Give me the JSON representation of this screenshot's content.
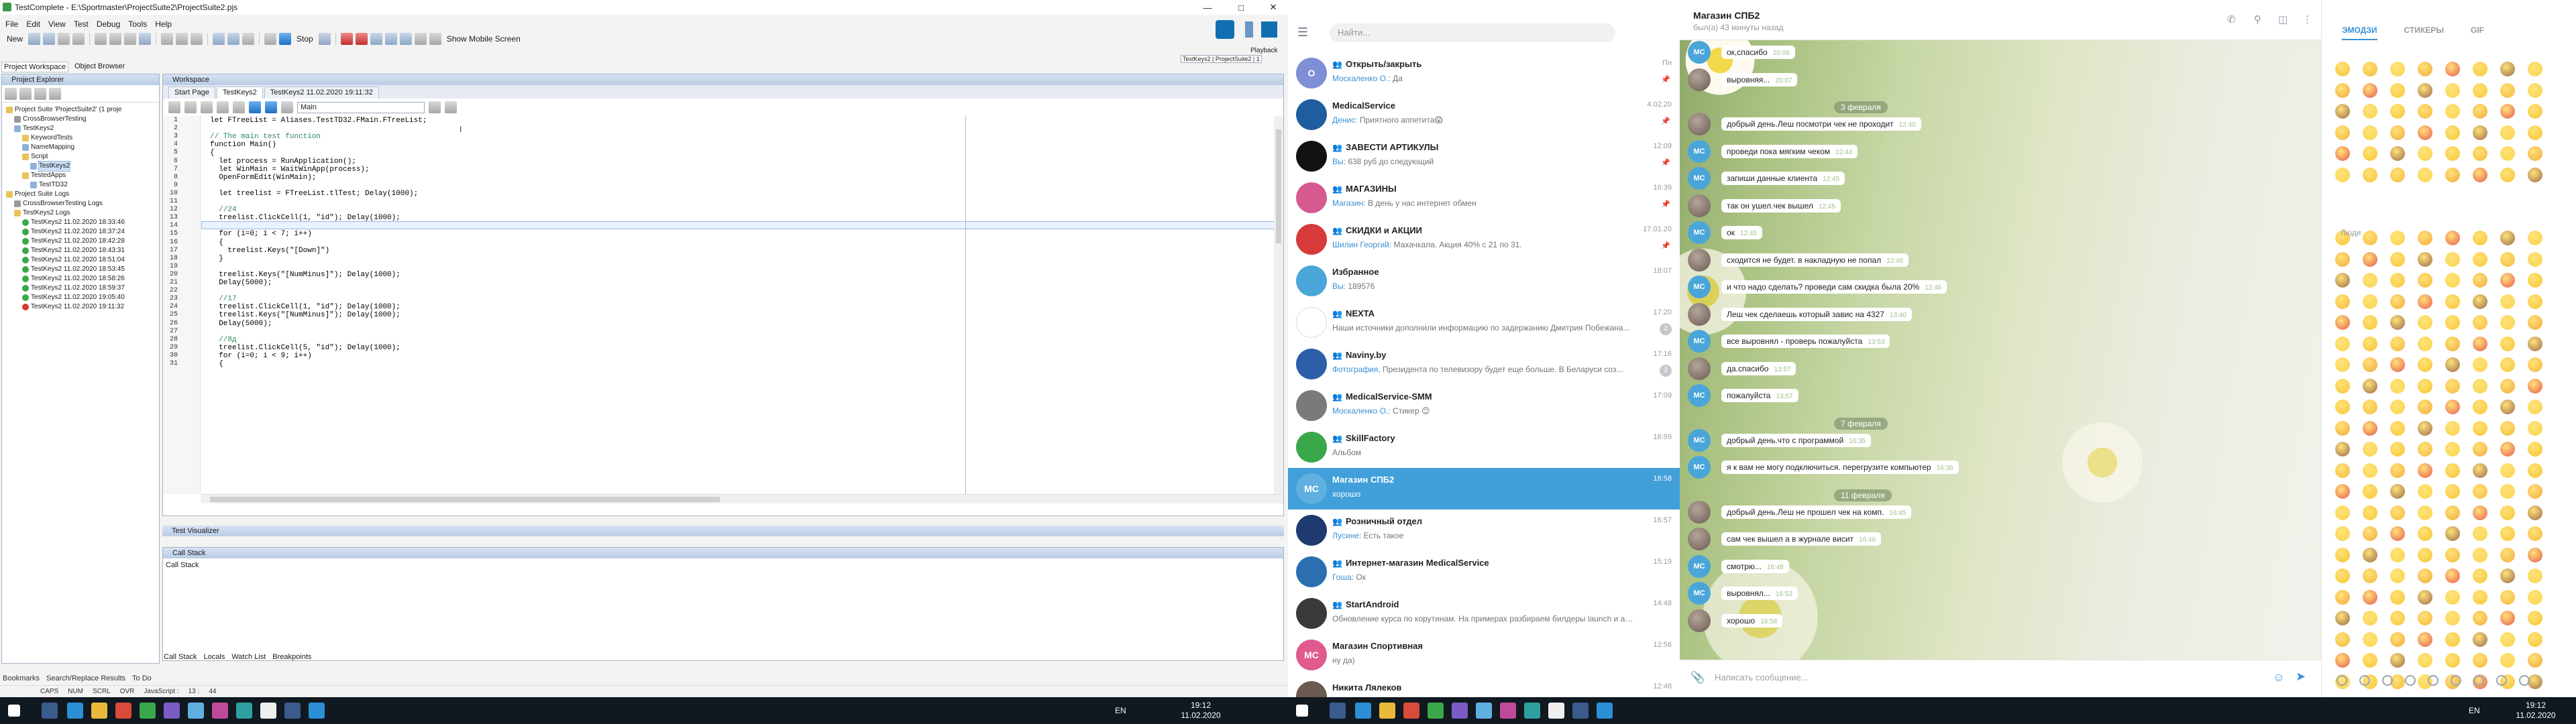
{
  "ide": {
    "title": "TestComplete - E:\\Sportmaster\\ProjectSuite2\\ProjectSuite2.pjs",
    "menu": [
      "File",
      "Edit",
      "View",
      "Test",
      "Debug",
      "Tools",
      "Help"
    ],
    "toolbar": {
      "new_label": "New",
      "stop_label": "Stop",
      "show_mobile_label": "Show Mobile Screen"
    },
    "playback": {
      "label": "Playback",
      "test_name": "TestKeys2 | ProjectSuite2 | 1"
    },
    "top_tabs": [
      "Project Workspace",
      "Object Browser"
    ],
    "project_explorer": {
      "title": "Project Explorer",
      "tree": [
        {
          "text": "Project Suite 'ProjectSuite2' (1 proje",
          "indent": 0,
          "icon": "folder"
        },
        {
          "text": "CrossBrowserTesting",
          "indent": 1,
          "icon": "grey"
        },
        {
          "text": "TestKeys2",
          "indent": 1,
          "icon": "doc"
        },
        {
          "text": "KeywordTests",
          "indent": 2,
          "icon": "folder"
        },
        {
          "text": "NameMapping",
          "indent": 2,
          "icon": "doc"
        },
        {
          "text": "Script",
          "indent": 2,
          "icon": "folder"
        },
        {
          "text": "TestKeys2",
          "indent": 3,
          "icon": "doc",
          "selected": true
        },
        {
          "text": "TestedApps",
          "indent": 2,
          "icon": "folder"
        },
        {
          "text": "TestTD32",
          "indent": 3,
          "icon": "doc"
        },
        {
          "text": "Project Suite Logs",
          "indent": 0,
          "icon": "folder"
        },
        {
          "text": "CrossBrowserTesting Logs",
          "indent": 1,
          "icon": "grey"
        },
        {
          "text": "TestKeys2 Logs",
          "indent": 1,
          "icon": "folder"
        },
        {
          "text": "TestKeys2 11.02.2020 18:33:46",
          "indent": 2,
          "icon": "ok"
        },
        {
          "text": "TestKeys2 11.02.2020 18:37:24",
          "indent": 2,
          "icon": "ok"
        },
        {
          "text": "TestKeys2 11.02.2020 18:42:28",
          "indent": 2,
          "icon": "ok"
        },
        {
          "text": "TestKeys2 11.02.2020 18:43:31",
          "indent": 2,
          "icon": "ok"
        },
        {
          "text": "TestKeys2 11.02.2020 18:51:04",
          "indent": 2,
          "icon": "ok"
        },
        {
          "text": "TestKeys2 11.02.2020 18:53:45",
          "indent": 2,
          "icon": "ok"
        },
        {
          "text": "TestKeys2 11.02.2020 18:58:26",
          "indent": 2,
          "icon": "ok"
        },
        {
          "text": "TestKeys2 11.02.2020 18:59:37",
          "indent": 2,
          "icon": "ok"
        },
        {
          "text": "TestKeys2 11.02.2020 19:05:40",
          "indent": 2,
          "icon": "ok"
        },
        {
          "text": "TestKeys2 11.02.2020 19:11:32",
          "indent": 2,
          "icon": "err"
        }
      ]
    },
    "workspace": {
      "title": "Workspace",
      "tabs": [
        "Start Page",
        "TestKeys2",
        "TestKeys2 11.02.2020 19:11:32"
      ],
      "active_tab": 1,
      "function_combo": "Main"
    },
    "code": {
      "selected_line": 14,
      "lines": [
        {
          "n": 1,
          "t": "let FTreeList = Aliases.TestTD32.FMain.FTreeList;"
        },
        {
          "n": 2,
          "t": ""
        },
        {
          "n": 3,
          "t": "// The main test function",
          "c": "cm"
        },
        {
          "n": 4,
          "t": "function Main()"
        },
        {
          "n": 5,
          "t": "{"
        },
        {
          "n": 6,
          "t": "  let process = RunApplication();"
        },
        {
          "n": 7,
          "t": "  let WinMain = WaitWinApp(process);"
        },
        {
          "n": 8,
          "t": "  OpenFormEdit(WinMain);"
        },
        {
          "n": 9,
          "t": ""
        },
        {
          "n": 10,
          "t": "  let treelist = FTreeList.tlTest; Delay(1000);"
        },
        {
          "n": 11,
          "t": ""
        },
        {
          "n": 12,
          "t": "  //24",
          "c": "cm"
        },
        {
          "n": 13,
          "t": "  treelist.ClickCell(1, \"id\"); Delay(1000);"
        },
        {
          "n": 14,
          "t": ""
        },
        {
          "n": 15,
          "t": "  for (i=0; i < 7; i++)"
        },
        {
          "n": 16,
          "t": "  {"
        },
        {
          "n": 17,
          "t": "    treelist.Keys(\"[Down]\")"
        },
        {
          "n": 18,
          "t": "  }"
        },
        {
          "n": 19,
          "t": ""
        },
        {
          "n": 20,
          "t": "  treelist.Keys(\"[NumMinus]\"); Delay(1000);"
        },
        {
          "n": 21,
          "t": "  Delay(5000);"
        },
        {
          "n": 22,
          "t": ""
        },
        {
          "n": 23,
          "t": "  //17",
          "c": "cm"
        },
        {
          "n": 24,
          "t": "  treelist.ClickCell(1, \"id\"); Delay(1000);"
        },
        {
          "n": 25,
          "t": "  treelist.Keys(\"[NumMinus]\"); Delay(1000);"
        },
        {
          "n": 26,
          "t": "  Delay(5000);"
        },
        {
          "n": 27,
          "t": ""
        },
        {
          "n": 28,
          "t": "  //8д",
          "c": "cm"
        },
        {
          "n": 29,
          "t": "  treelist.ClickCell(5, \"id\"); Delay(1000);"
        },
        {
          "n": 30,
          "t": "  for (i=0; i < 9; i++)"
        },
        {
          "n": 31,
          "t": "  {"
        }
      ]
    },
    "test_visualizer": "Test Visualizer",
    "call_stack": {
      "title": "Call Stack",
      "content": "Call Stack"
    },
    "bottom_tabs": [
      "Call Stack",
      "Locals",
      "Watch List",
      "Breakpoints"
    ],
    "lower_left_tabs": [
      "Bookmarks",
      "Search/Replace Results",
      "To Do"
    ],
    "status": [
      "CAPS",
      "NUM",
      "SCRL",
      "OVR",
      "JavaScript :",
      "13 :",
      "44"
    ]
  },
  "telegram": {
    "search_placeholder": "Найти...",
    "chats": [
      {
        "name": "Открыть/закрыть",
        "who": "Москаленко О.:",
        "preview": "Да",
        "time": "Пн",
        "avatar": "О",
        "color": "#7e8fd6",
        "group": true,
        "badge": "",
        "pin": true
      },
      {
        "name": "MedicalService",
        "who": "Денис:",
        "preview": "Приятного аппетита😱",
        "time": "4.02.20",
        "avatar": "",
        "color": "#1f5e9e",
        "group": false,
        "badge": "",
        "pin": true
      },
      {
        "name": "ЗАВЕСТИ АРТИКУЛЫ",
        "who": "Вы:",
        "preview": "638 руб до следующий",
        "time": "12:09",
        "avatar": "",
        "color": "#111111",
        "group": true,
        "badge": "",
        "pin": true
      },
      {
        "name": "МАГАЗИНЫ",
        "who": "Магазин:",
        "preview": "В день у нас интернет обмен",
        "time": "16:39",
        "avatar": "",
        "color": "#d65a8f",
        "group": true,
        "badge": "",
        "pin": true
      },
      {
        "name": "СКИДКИ и АКЦИИ",
        "who": "Шилин Георгий:",
        "preview": "Махачкала. Акция 40% с 21 по 31.",
        "time": "17.01.20",
        "avatar": "",
        "color": "#d63a3a",
        "group": true,
        "badge": "",
        "pin": true
      },
      {
        "name": "Избранное",
        "who": "Вы:",
        "preview": "189576",
        "time": "18:07",
        "avatar": "",
        "color": "#4aa6d9",
        "group": false,
        "badge": "",
        "pin": false
      },
      {
        "name": "NEXTA",
        "who": "",
        "preview": "Наши источники дополнили информацию по задержанию Дмитрия Побежана...",
        "time": "17:20",
        "avatar": "",
        "color": "#ffffff",
        "group": true,
        "badge": "2",
        "pin": false
      },
      {
        "name": "Naviny.by",
        "who": "Фотография,",
        "preview": "Президента по телевизору будет еще больше. В Беларуси соз...",
        "time": "17:16",
        "avatar": "",
        "color": "#2c5fa7",
        "group": true,
        "badge": "3",
        "pin": false
      },
      {
        "name": "MedicalService-SMM",
        "who": "Москаленко О.:",
        "preview": "Стикер 😊",
        "time": "17:09",
        "avatar": "",
        "color": "#7a7a7a",
        "group": true,
        "badge": "",
        "pin": false
      },
      {
        "name": "SkillFactory",
        "who": "",
        "preview": "Альбом",
        "time": "16:59",
        "avatar": "",
        "color": "#3aa84a",
        "group": true,
        "badge": "",
        "pin": false
      },
      {
        "name": "Магазин СПБ2",
        "who": "",
        "preview": "хорошо",
        "time": "16:58",
        "avatar": "МС",
        "color": "#5fb0e0",
        "group": false,
        "badge": "",
        "pin": false,
        "active": true
      },
      {
        "name": "Розничный отдел",
        "who": "Лусине:",
        "preview": "Есть такое",
        "time": "16:57",
        "avatar": "",
        "color": "#1f3a6e",
        "group": true,
        "badge": "",
        "pin": false
      },
      {
        "name": "Интернет-магазин MedicalService",
        "who": "Гоша:",
        "preview": "Ок",
        "time": "15:19",
        "avatar": "",
        "color": "#2b6fb0",
        "group": true,
        "badge": "",
        "pin": false
      },
      {
        "name": "StartAndroid",
        "who": "",
        "preview": "Обновление курса по корутинам. На примерах разбираем билдеры launch и as...",
        "time": "14:48",
        "avatar": "",
        "color": "#3a3a3a",
        "group": true,
        "badge": "",
        "pin": false
      },
      {
        "name": "Магазин Спортивная",
        "who": "",
        "preview": "ну да)",
        "time": "12:56",
        "avatar": "МС",
        "color": "#e05a8f",
        "group": false,
        "badge": "",
        "pin": false
      },
      {
        "name": "Никита Лялеков",
        "who": "",
        "preview": "",
        "time": "12:48",
        "avatar": "",
        "color": "#6b5a52",
        "group": false,
        "badge": "",
        "pin": false
      }
    ],
    "chat": {
      "title": "Магазин СПБ2",
      "status": "был(а) 43 минуты назад",
      "composer_placeholder": "Написать сообщение...",
      "items": [
        {
          "kind": "msg",
          "text": "ок,спасибо",
          "time": "20:06",
          "avatar": "mc"
        },
        {
          "kind": "msg",
          "text": "выровняя...",
          "time": "20:07",
          "avatar": "ph"
        },
        {
          "kind": "date",
          "text": "3 февраля"
        },
        {
          "kind": "msg",
          "text": "добрый день.Леш посмотри чек не проходит",
          "time": "12:40",
          "avatar": "ph"
        },
        {
          "kind": "msg",
          "text": "проведи пока мягким чеком",
          "time": "12:44",
          "avatar": "mc"
        },
        {
          "kind": "msg",
          "text": "запиши данные клиента",
          "time": "12:45",
          "avatar": "mc"
        },
        {
          "kind": "msg",
          "text": "так он ушел.чек вышел",
          "time": "12:45",
          "avatar": "ph"
        },
        {
          "kind": "msg",
          "text": "ок",
          "time": "12:45",
          "avatar": "mc"
        },
        {
          "kind": "msg",
          "text": "сходится не будет. в накладную не попал",
          "time": "12:46",
          "avatar": "ph"
        },
        {
          "kind": "msg",
          "text": "и что надо сделать? проведи сам скидка была 20%",
          "time": "12:46",
          "avatar": "mc"
        },
        {
          "kind": "msg",
          "text": "Леш чек сделаешь который завис на 4327",
          "time": "13:40",
          "avatar": "ph"
        },
        {
          "kind": "msg",
          "text": "все выровнял - проверь пожалуйста",
          "time": "13:53",
          "avatar": "mc"
        },
        {
          "kind": "msg",
          "text": "да.спасибо",
          "time": "13:57",
          "avatar": "ph"
        },
        {
          "kind": "msg",
          "text": "пожалуйста",
          "time": "13:57",
          "avatar": "mc"
        },
        {
          "kind": "date",
          "text": "7 февраля"
        },
        {
          "kind": "msg",
          "text": "добрый день.что с программой",
          "time": "16:35",
          "avatar": "mc"
        },
        {
          "kind": "msg",
          "text": "я к вам не могу подключиться. перегрузите компьютер",
          "time": "16:36",
          "avatar": "mc"
        },
        {
          "kind": "date",
          "text": "11 февраля"
        },
        {
          "kind": "msg",
          "text": "добрый день.Леш не прошел чек на комп.",
          "time": "16:45",
          "avatar": "ph"
        },
        {
          "kind": "msg",
          "text": "сам чек вышел а в журнале висит",
          "time": "16:46",
          "avatar": "ph"
        },
        {
          "kind": "msg",
          "text": "смотрю...",
          "time": "16:48",
          "avatar": "mc"
        },
        {
          "kind": "msg",
          "text": "выровнял...",
          "time": "16:53",
          "avatar": "mc"
        },
        {
          "kind": "msg",
          "text": "хорошо",
          "time": "16:58",
          "avatar": "ph"
        }
      ]
    },
    "emoji_tabs": [
      "ЭМОДЗИ",
      "СТИКЕРЫ",
      "GIF"
    ],
    "emoji_section": "Люди"
  },
  "taskbar": {
    "left": {
      "time": "19:12",
      "date": "11.02.2020",
      "lang": "EN"
    },
    "right": {
      "time": "19:12",
      "date": "11.02.2020",
      "lang": "EN"
    }
  }
}
